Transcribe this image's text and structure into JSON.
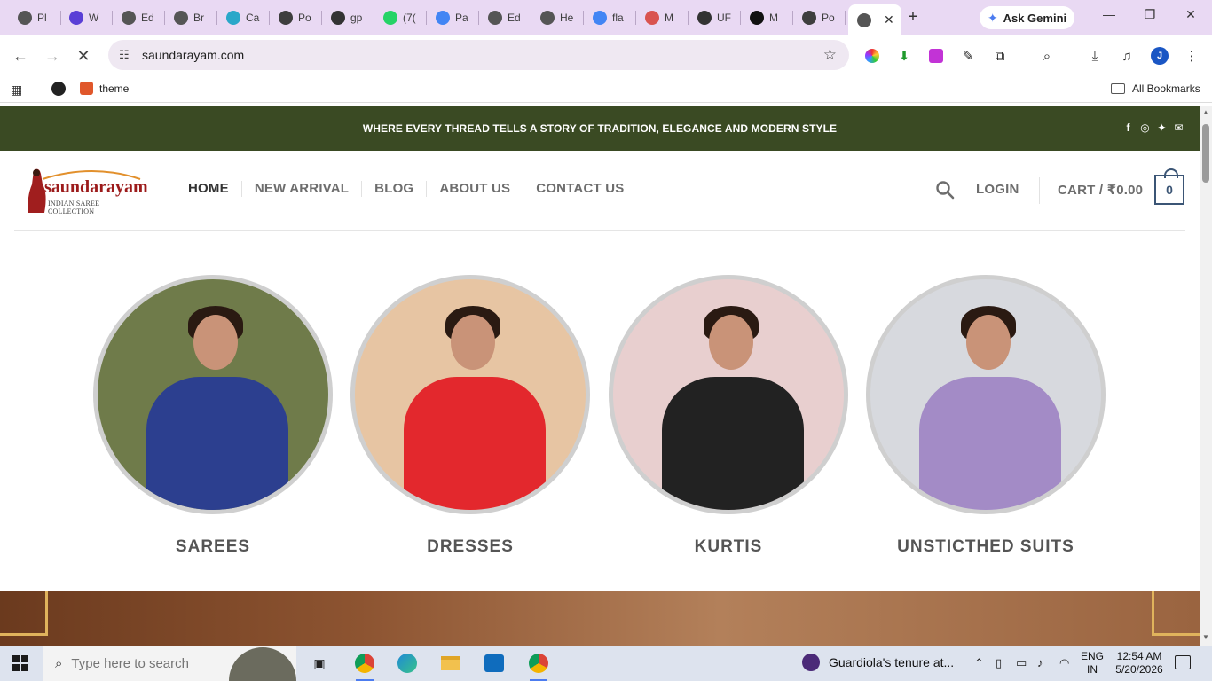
{
  "browser": {
    "tabs": [
      {
        "label": "Pl",
        "icon": "globe-icon",
        "color": "#555555"
      },
      {
        "label": "W",
        "icon": "webflow-icon",
        "color": "#5a3fd6"
      },
      {
        "label": "Ed",
        "icon": "globe-icon",
        "color": "#555555"
      },
      {
        "label": "Br",
        "icon": "globe-icon",
        "color": "#555555"
      },
      {
        "label": "Ca",
        "icon": "spiral-icon",
        "color": "#2aa7c9"
      },
      {
        "label": "Po",
        "icon": "wordpress-icon",
        "color": "#3e3e3e"
      },
      {
        "label": "gp",
        "icon": "gplpl-icon",
        "color": "#333333"
      },
      {
        "label": "(7(",
        "icon": "whatsapp-icon",
        "color": "#25d366"
      },
      {
        "label": "Pa",
        "icon": "google-icon",
        "color": "#4285f4"
      },
      {
        "label": "Ed",
        "icon": "globe-icon",
        "color": "#555555"
      },
      {
        "label": "He",
        "icon": "globe-icon",
        "color": "#555555"
      },
      {
        "label": "fla",
        "icon": "google-icon",
        "color": "#4285f4"
      },
      {
        "label": "M",
        "icon": "sparkle-icon",
        "color": "#d9534f"
      },
      {
        "label": "UF",
        "icon": "openai-icon",
        "color": "#333333"
      },
      {
        "label": "M",
        "icon": "v-icon",
        "color": "#111111"
      },
      {
        "label": "Po",
        "icon": "wordpress-icon",
        "color": "#3e3e3e"
      }
    ],
    "active_tab_icon_color": "#555555",
    "ask_gemini": "Ask Gemini",
    "url": "saundarayam.com",
    "avatar_letter": "J",
    "bookmarks": {
      "item": "theme",
      "all": "All Bookmarks"
    }
  },
  "site": {
    "announcement": "WHERE EVERY THREAD TELLS A STORY OF TRADITION, ELEGANCE AND MODERN STYLE",
    "logo": {
      "brand": "saundarayam",
      "tagline": "INDIAN SAREE COLLECTION"
    },
    "nav": [
      "HOME",
      "NEW ARRIVAL",
      "BLOG",
      "ABOUT US",
      "CONTACT US"
    ],
    "login": "LOGIN",
    "cart": "CART / ₹0.00",
    "cart_count": "0",
    "categories": [
      {
        "label": "SAREES",
        "bg": "#6f7b4a",
        "dress": "#2c3f8f"
      },
      {
        "label": "DRESSES",
        "bg": "#e7c5a3",
        "dress": "#e3282d"
      },
      {
        "label": "KURTIS",
        "bg": "#e8cfcf",
        "dress": "#222222"
      },
      {
        "label": "UNSTICTHED SUITS",
        "bg": "#d7d9de",
        "dress": "#a38bc6"
      }
    ],
    "brand_color": "#3a4a23",
    "accent_color": "#3b5575"
  },
  "taskbar": {
    "search_placeholder": "Type here to search",
    "news": "Guardiola's tenure at...",
    "lang_top": "ENG",
    "lang_bottom": "IN",
    "time": "12:54 AM",
    "date": "5/20/2026"
  }
}
